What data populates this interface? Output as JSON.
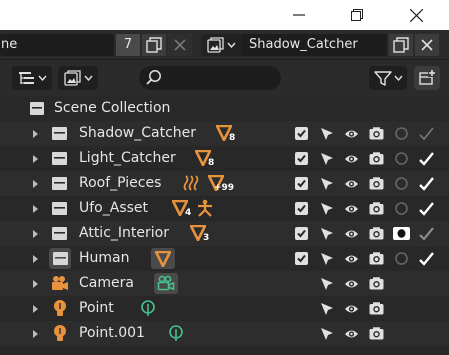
{
  "window": {
    "minimize_icon": "minimize-icon",
    "maximize_icon": "restore-icon",
    "close_icon": "close-icon"
  },
  "header": {
    "scene_name": "ne",
    "scene_users": "7",
    "view_layer_name": "Shadow_Catcher"
  },
  "toolbar": {
    "display_mode_icon": "outliner-display-icon",
    "filter_icon": "funnel-icon",
    "new_collection_icon": "new-collection-icon",
    "search_placeholder": ""
  },
  "outliner": {
    "root": "Scene Collection",
    "items": [
      {
        "name": "Shadow_Catcher",
        "kind": "collection",
        "badge": "8",
        "badge_type": "mesh",
        "checked": true,
        "hide_render_dim": true
      },
      {
        "name": "Light_Catcher",
        "kind": "collection",
        "badge": "8",
        "badge_type": "mesh",
        "checked": true
      },
      {
        "name": "Roof_Pieces",
        "kind": "collection",
        "badge": "+99",
        "badge_type": "modifier-mesh",
        "checked": true
      },
      {
        "name": "Ufo_Asset",
        "kind": "collection",
        "badge": "4",
        "badge_type": "mesh-armature",
        "checked": true
      },
      {
        "name": "Attic_Interior",
        "kind": "collection",
        "badge": "3",
        "badge_type": "mesh",
        "checked": true,
        "holdout": true
      },
      {
        "name": "Human",
        "kind": "collection-active",
        "badge": "",
        "badge_type": "mesh-boxed",
        "checked": true
      },
      {
        "name": "Camera",
        "kind": "camera-object",
        "badge": "",
        "badge_type": "camera-data"
      },
      {
        "name": "Point",
        "kind": "light-object",
        "badge": "",
        "badge_type": "light-data"
      },
      {
        "name": "Point.001",
        "kind": "light-object",
        "badge": "",
        "badge_type": "light-data"
      }
    ]
  },
  "colors": {
    "background": "#282828",
    "row_alt": "#2d2d2d",
    "mesh_orange": "#e7933e",
    "data_green": "#47c08c",
    "text": "#e6e6e6"
  }
}
